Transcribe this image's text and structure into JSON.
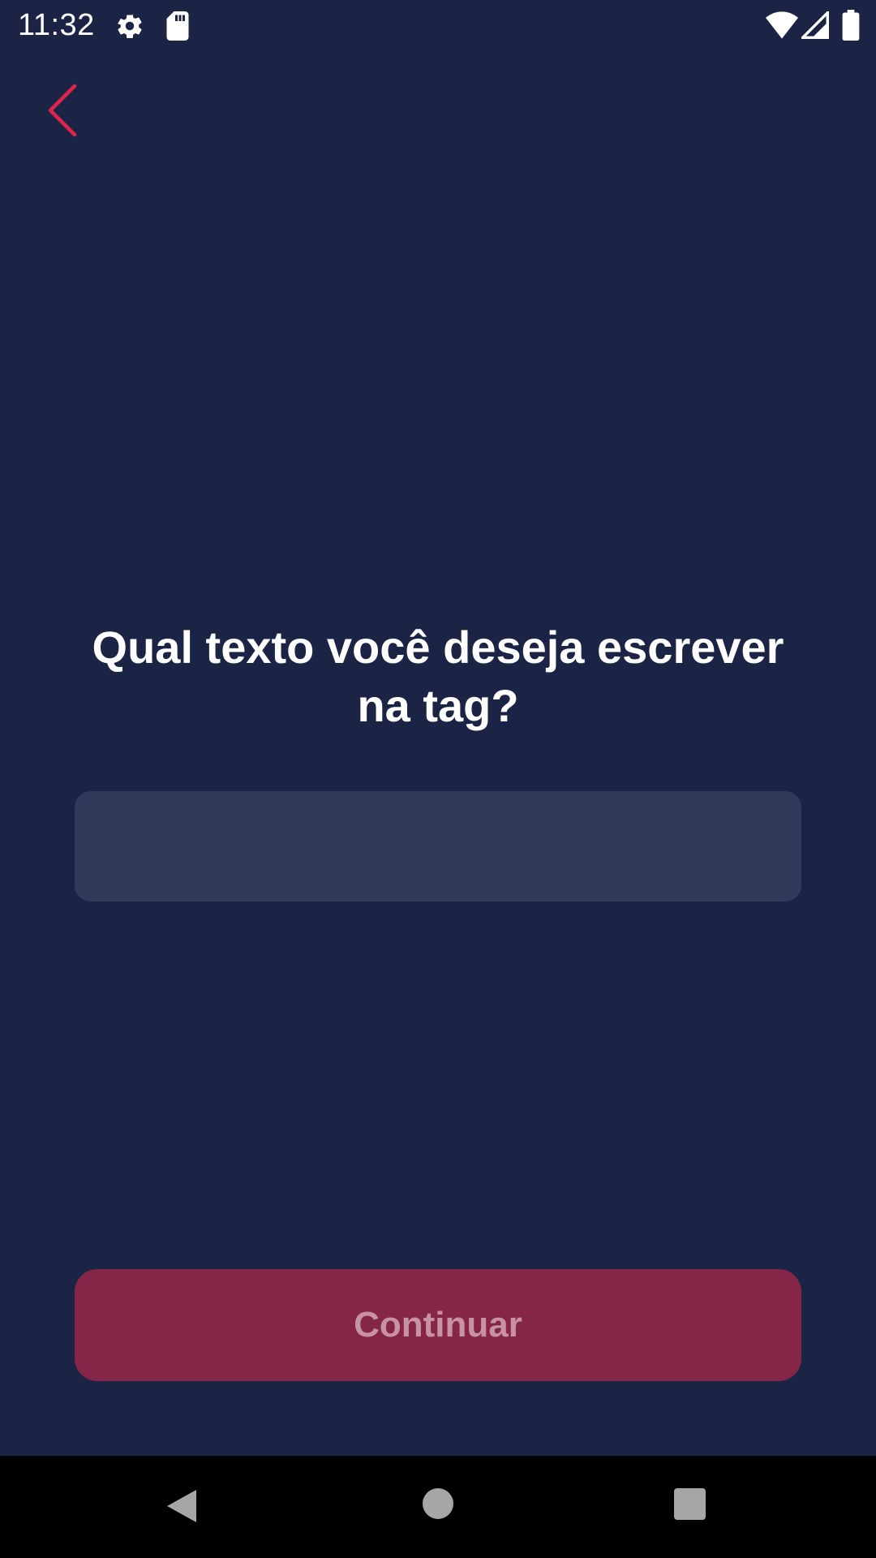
{
  "status_bar": {
    "time": "11:32",
    "icons": [
      "gear-icon",
      "sd-card-icon",
      "wifi-icon",
      "signal-icon",
      "battery-icon"
    ]
  },
  "header": {
    "back_icon": "chevron-left-icon",
    "accent_color": "#e0234e"
  },
  "main": {
    "title": "Qual texto você deseja escrever na tag?",
    "input": {
      "value": "",
      "placeholder": ""
    },
    "continue_label": "Continuar"
  },
  "nav_bar": {
    "icons": [
      "nav-back-icon",
      "nav-home-icon",
      "nav-recents-icon"
    ]
  },
  "colors": {
    "background": "#1b2444",
    "input_background": "#313a59",
    "button_background": "#852648",
    "button_text": "#c792a6"
  }
}
